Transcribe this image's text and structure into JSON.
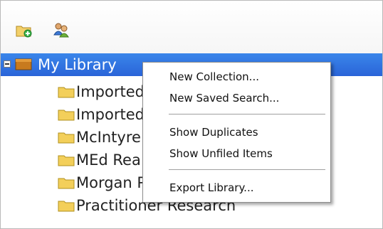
{
  "toolbar": {
    "buttons": [
      {
        "icon": "new-collection-icon"
      },
      {
        "icon": "new-group-icon"
      }
    ]
  },
  "tree": {
    "root": {
      "label": "My Library",
      "expanded": true,
      "selected": true
    },
    "items": [
      {
        "label": "Imported"
      },
      {
        "label": "Imported"
      },
      {
        "label": "McIntyre"
      },
      {
        "label": "MEd Rea"
      },
      {
        "label": "Morgan PhD Thesis Library"
      },
      {
        "label": "Practitioner Research"
      }
    ]
  },
  "context_menu": {
    "items": [
      {
        "label": "New Collection..."
      },
      {
        "label": "New Saved Search..."
      },
      {
        "label": "Show Duplicates"
      },
      {
        "label": "Show Unfiled Items"
      },
      {
        "label": "Export Library..."
      }
    ]
  },
  "colors": {
    "selection": "#2f6fe0",
    "folder": "#f3cf5a",
    "library_icon": "#c77a1e"
  }
}
